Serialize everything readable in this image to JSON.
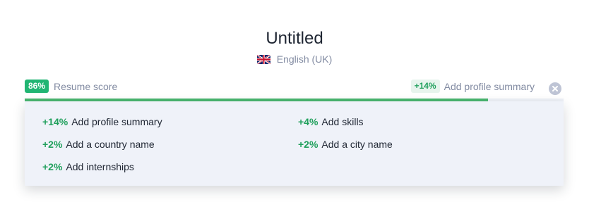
{
  "header": {
    "title": "Untitled",
    "language": "English (UK)",
    "language_icon": "uk-flag-icon"
  },
  "score": {
    "value_label": "86%",
    "value": 86,
    "label": "Resume score",
    "color": "#21b573"
  },
  "top_tip": {
    "badge": "+14%",
    "label": "Add profile summary"
  },
  "close_icon": "close-icon",
  "suggestions": [
    {
      "pct": "+14%",
      "label": "Add profile summary"
    },
    {
      "pct": "+4%",
      "label": "Add skills"
    },
    {
      "pct": "+2%",
      "label": "Add a country name"
    },
    {
      "pct": "+2%",
      "label": "Add a city name"
    },
    {
      "pct": "+2%",
      "label": "Add internships"
    }
  ]
}
